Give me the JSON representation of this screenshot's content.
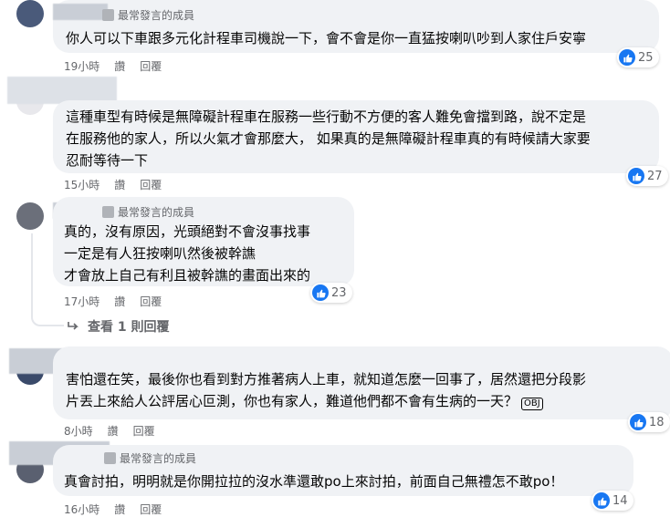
{
  "comments": [
    {
      "badge": "最常發言的成員",
      "lines": [
        "你人可以下車跟多元化計程車司機說一下，會不會是你一直猛按喇叭吵到人家住戶安寧"
      ],
      "time": "19小時",
      "like_label": "讚",
      "reply_label": "回覆",
      "reactions": "25"
    },
    {
      "badge": "",
      "lines": [
        "這種車型有時候是無障礙計程車在服務一些行動不方便的客人難免會擋到路，說不定是",
        "在服務他的家人，所以火氣才會那麼大， 如果真的是無障礙計程車真的有時候請大家要",
        "忍耐等待一下"
      ],
      "time": "15小時",
      "like_label": "讚",
      "reply_label": "回覆",
      "reactions": "27"
    },
    {
      "badge": "最常發言的成員",
      "lines": [
        "真的，沒有原因，光頭絕對不會沒事找事",
        "一定是有人狂按喇叭然後被幹譙",
        "才會放上自己有利且被幹譙的畫面出來的"
      ],
      "time": "17小時",
      "like_label": "讚",
      "reply_label": "回覆",
      "reactions": "23"
    },
    {
      "badge": "",
      "lines": [
        "害怕還在笑，最後你也看到對方推著病人上車，就知道怎麼一回事了，居然還把分段影",
        "片丟上來給人公評居心叵測，你也有家人，難道他們都不會有生病的一天？"
      ],
      "time": "8小時",
      "like_label": "讚",
      "reply_label": "回覆",
      "reactions": "18"
    },
    {
      "badge": "最常發言的成員",
      "lines": [
        "真會討拍，明明就是你開拉拉的沒水準還敢po上來討拍，前面自己無禮怎不敢po！"
      ],
      "time": "16小時",
      "like_label": "讚",
      "reply_label": "回覆",
      "reactions": "14"
    }
  ],
  "view_replies": "查看 1 則回覆",
  "icons": {
    "like": "thumbs-up-icon",
    "reply_arrow": "reply-arrow-icon",
    "badge": "member-badge-icon"
  },
  "colors": {
    "bubble": "#f0f2f5",
    "like_blue": "#1877f2",
    "meta_gray": "#65676b"
  }
}
